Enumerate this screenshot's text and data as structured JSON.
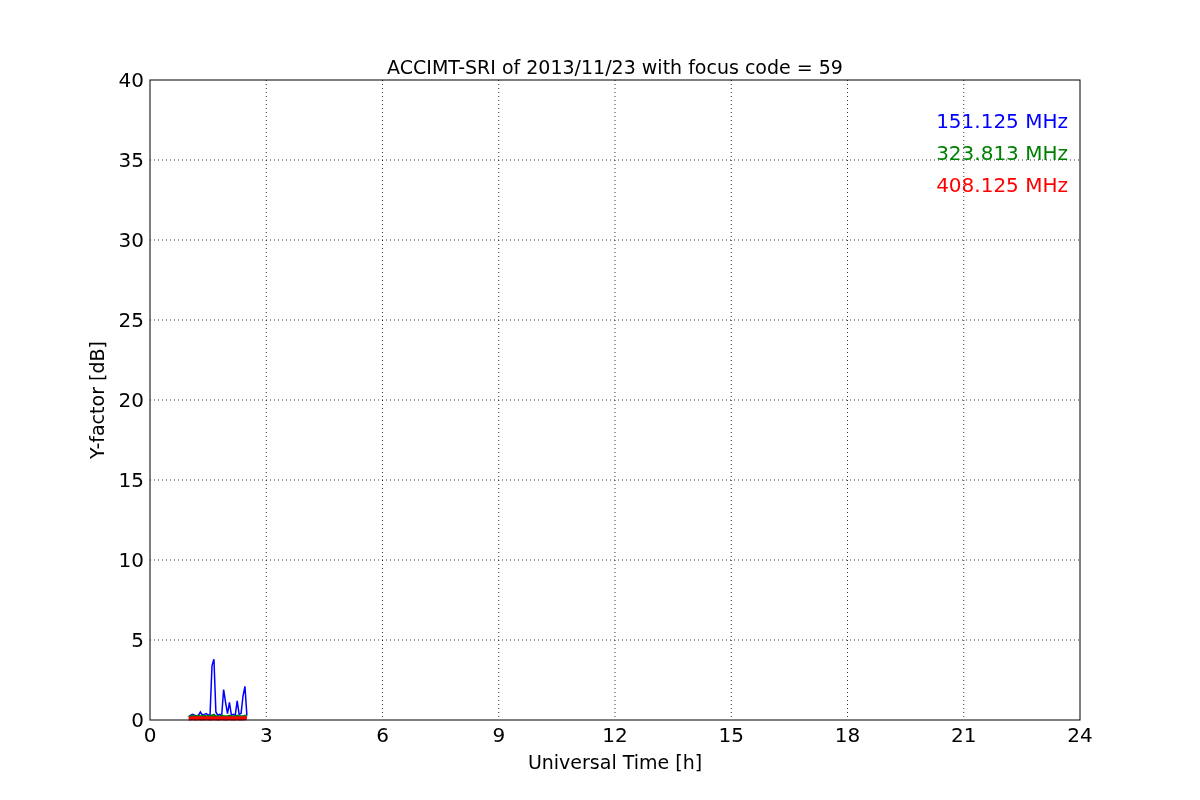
{
  "chart_data": {
    "type": "line",
    "title": "ACCIMT-SRI of 2013/11/23 with focus code = 59",
    "xlabel": "Universal Time [h]",
    "ylabel": "Y-factor [dB]",
    "x": [
      1.0,
      1.05,
      1.1,
      1.15,
      1.2,
      1.25,
      1.3,
      1.35,
      1.4,
      1.45,
      1.5,
      1.55,
      1.6,
      1.65,
      1.7,
      1.75,
      1.8,
      1.85,
      1.9,
      1.95,
      2.0,
      2.05,
      2.1,
      2.15,
      2.2,
      2.25,
      2.3,
      2.35,
      2.4,
      2.45,
      2.5
    ],
    "series": [
      {
        "name": "151.125 MHz",
        "color": "#0000ff",
        "values": [
          0.2,
          0.3,
          0.35,
          0.3,
          0.25,
          0.3,
          0.5,
          0.3,
          0.35,
          0.4,
          0.3,
          0.35,
          3.4,
          3.8,
          0.5,
          0.3,
          0.35,
          0.3,
          1.9,
          1.1,
          0.4,
          1.1,
          0.3,
          0.35,
          0.3,
          1.2,
          0.35,
          0.4,
          1.5,
          2.1,
          0.3
        ]
      },
      {
        "name": "323.813 MHz",
        "color": "#008000",
        "values": [
          0.2,
          0.2,
          0.25,
          0.2,
          0.2,
          0.25,
          0.2,
          0.2,
          0.25,
          0.2,
          0.2,
          0.2,
          0.25,
          0.3,
          0.2,
          0.2,
          0.2,
          0.25,
          0.2,
          0.2,
          0.2,
          0.25,
          0.2,
          0.2,
          0.2,
          0.25,
          0.2,
          0.2,
          0.2,
          0.25,
          0.2
        ]
      },
      {
        "name": "408.125 MHz",
        "color": "#ff0000",
        "values": [
          0.1,
          0.1,
          0.12,
          0.1,
          0.1,
          0.12,
          0.1,
          0.1,
          0.1,
          0.12,
          0.1,
          0.1,
          0.1,
          0.12,
          0.1,
          0.1,
          0.1,
          0.12,
          0.1,
          0.1,
          0.1,
          0.12,
          0.1,
          0.1,
          0.1,
          0.12,
          0.1,
          0.1,
          0.1,
          0.12,
          0.1
        ]
      }
    ],
    "xlim": [
      0,
      24
    ],
    "ylim": [
      0,
      40
    ],
    "xticks": [
      0,
      3,
      6,
      9,
      12,
      15,
      18,
      21,
      24
    ],
    "yticks": [
      0,
      5,
      10,
      15,
      20,
      25,
      30,
      35,
      40
    ],
    "grid": true
  }
}
